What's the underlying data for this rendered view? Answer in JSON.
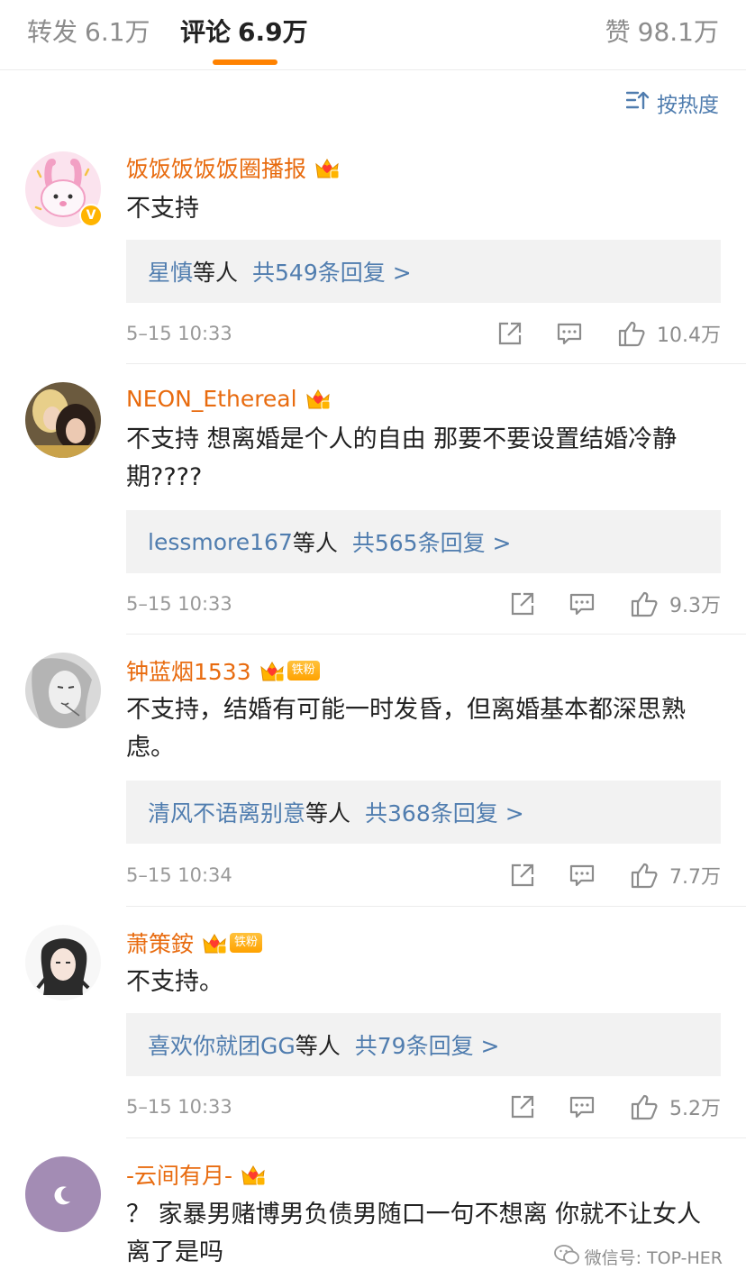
{
  "tabs": {
    "reposts": {
      "label": "转发",
      "count": "6.1万"
    },
    "comments": {
      "label": "评论",
      "count": "6.9万"
    },
    "likes": {
      "label": "赞",
      "count": "98.1万"
    }
  },
  "sort": {
    "label": "按热度"
  },
  "colors": {
    "accent": "#ff8200",
    "username": "#e86b0f",
    "link": "#507daf"
  },
  "comments": [
    {
      "username": "饭饭饭饭饭圈播报",
      "text": "不支持",
      "reply_users": "星慎",
      "reply_etc": "等人",
      "reply_count": "共549条回复 >",
      "time": "5–15 10:33",
      "likes": "10.4万",
      "verified": true
    },
    {
      "username": "NEON_Ethereal",
      "text": "不支持 想离婚是个人的自由 那要不要设置结婚冷静期????",
      "reply_users": "lessmore167",
      "reply_etc": "等人",
      "reply_count": "共565条回复 >",
      "time": "5–15 10:33",
      "likes": "9.3万"
    },
    {
      "username": "钟蓝烟1533",
      "badge": "铁粉",
      "text": "不支持，结婚有可能一时发昏，但离婚基本都深思熟虑。",
      "reply_users": "清风不语离别意",
      "reply_etc": "等人",
      "reply_count": "共368条回复 >",
      "time": "5–15 10:34",
      "likes": "7.7万"
    },
    {
      "username": "萧策銨",
      "badge": "铁粉",
      "text": "不支持。",
      "reply_users": "喜欢你就团GG",
      "reply_etc": "等人",
      "reply_count": "共79条回复 >",
      "time": "5–15 10:33",
      "likes": "5.2万"
    },
    {
      "username": "-云间有月-",
      "text": "？ 家暴男赌博男负债男随口一句不想离 你就不让女人离了是吗"
    }
  ],
  "watermark": "微信号: TOP-HER"
}
